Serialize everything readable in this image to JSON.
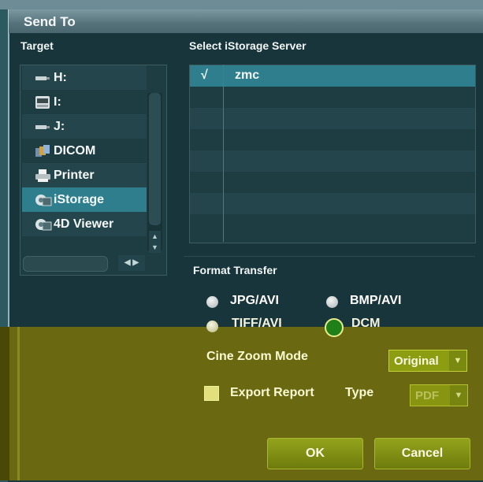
{
  "dialog": {
    "title": "Send To"
  },
  "target": {
    "label": "Target",
    "items": [
      {
        "label": "H:",
        "icon": "usb-drive-icon"
      },
      {
        "label": "I:",
        "icon": "dvd-drive-icon"
      },
      {
        "label": "J:",
        "icon": "usb-drive-icon"
      },
      {
        "label": "DICOM",
        "icon": "dicom-icon"
      },
      {
        "label": "Printer",
        "icon": "printer-icon"
      },
      {
        "label": "iStorage",
        "icon": "istorage-icon",
        "selected": true
      },
      {
        "label": "4D Viewer",
        "icon": "4d-viewer-icon"
      }
    ]
  },
  "server": {
    "label": "Select iStorage Server",
    "rows": [
      {
        "check": "√",
        "name": "zmc",
        "selected": true
      }
    ]
  },
  "format": {
    "label": "Format Transfer",
    "options": [
      {
        "label": "JPG/AVI",
        "selected": false
      },
      {
        "label": "BMP/AVI",
        "selected": false
      },
      {
        "label": "TIFF/AVI",
        "selected": false
      },
      {
        "label": "DCM",
        "selected": true
      }
    ]
  },
  "cine_zoom": {
    "label": "Cine Zoom Mode",
    "value": "Original"
  },
  "export_report": {
    "label": "Export Report",
    "checked": false
  },
  "type": {
    "label": "Type",
    "value": "PDF"
  },
  "buttons": {
    "ok": "OK",
    "cancel": "Cancel"
  },
  "colors": {
    "selection": "#2f7e8e",
    "overlay": "#6a6810",
    "background": "#18353b"
  }
}
